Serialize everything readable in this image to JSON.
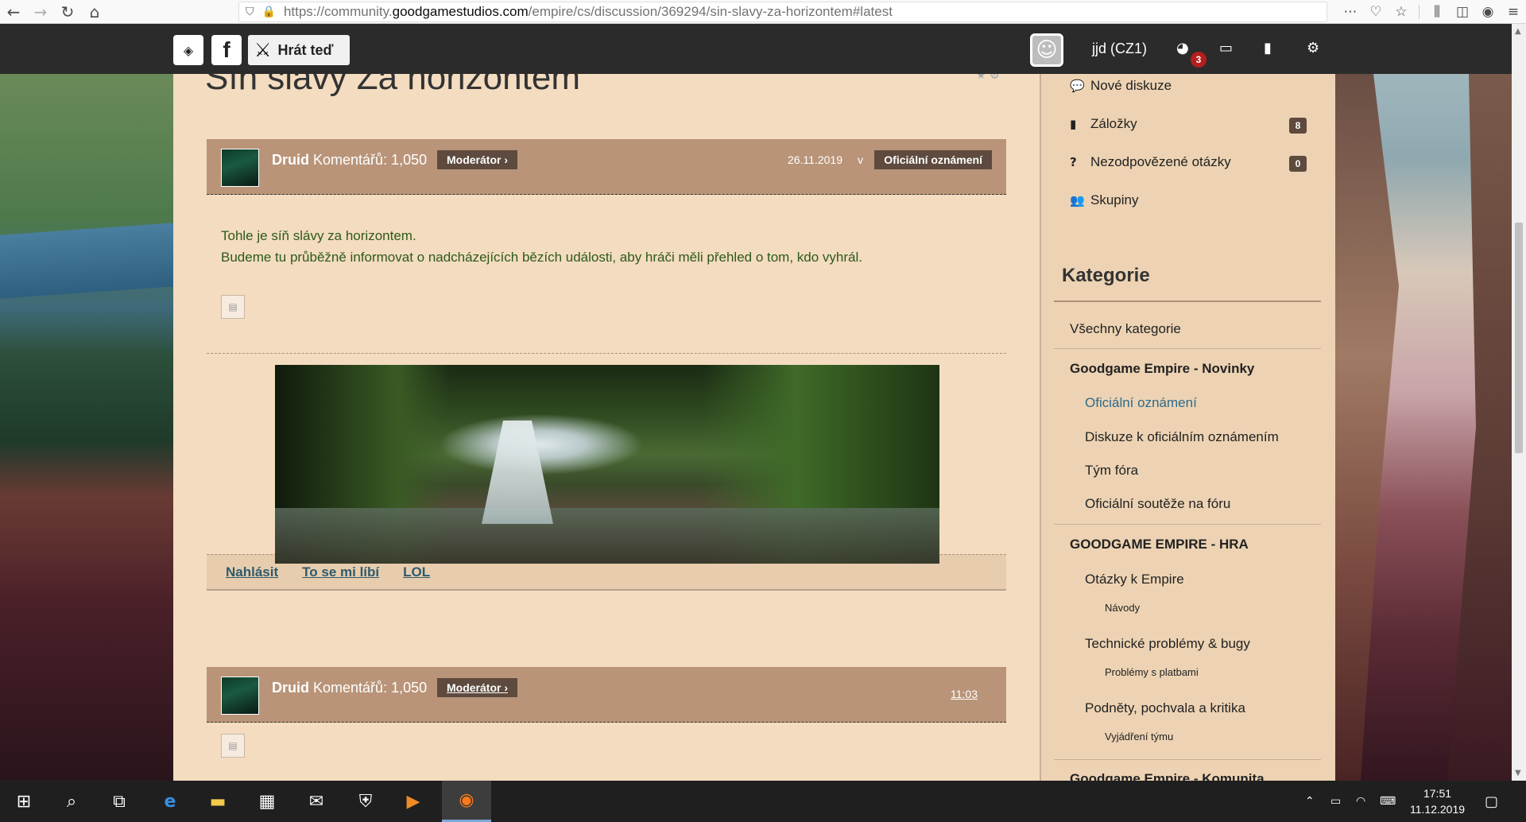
{
  "browser": {
    "url_prefix": "https://community.",
    "url_domain": "goodgamestudios.com",
    "url_path": "/empire/cs/discussion/369294/sin-slavy-za-horizontem#latest",
    "icons": [
      "back-icon",
      "forward-icon",
      "reload-icon",
      "home-icon",
      "shield-icon",
      "lock-icon",
      "more-icon",
      "pocket-icon",
      "star-icon",
      "library-icon",
      "sidebar-icon",
      "account-icon",
      "menu-icon"
    ]
  },
  "header": {
    "play_label": "Hrát teď",
    "username": "jjd (CZ1)",
    "notification_count": "3"
  },
  "page": {
    "title": "Síň slávy Za horizontem"
  },
  "posts": [
    {
      "author": "Druid",
      "comments": "Komentářů: 1,050",
      "role": "Moderátor ›",
      "date": "26.11.2019",
      "in_word": "v",
      "category": "Oficiální oznámení",
      "line1": "Tohle je síň slávy za horizontem.",
      "line2": "Budeme tu průběžně informovat o nadcházejících bězích události, aby hráči měli přehled o tom, kdo vyhrál."
    },
    {
      "author": "Druid",
      "comments": "Komentářů: 1,050",
      "role": "Moderátor ›",
      "date": "11:03"
    }
  ],
  "actions": {
    "report": "Nahlásit",
    "like": "To se mi líbí",
    "lol": "LOL"
  },
  "sidebar": {
    "items": [
      {
        "label": "Nové diskuze",
        "icon": "comments-icon"
      },
      {
        "label": "Záložky",
        "icon": "bookmark-icon",
        "badge": "8"
      },
      {
        "label": "Nezodpovězené otázky",
        "icon": "question-icon",
        "badge": "0"
      },
      {
        "label": "Skupiny",
        "icon": "users-icon"
      }
    ],
    "heading": "Kategorie",
    "categories": {
      "all": "Všechny kategorie",
      "news_group": "Goodgame Empire - Novinky",
      "official": "Oficiální oznámení",
      "official_discussion": "Diskuze k oficiálním oznámením",
      "team": "Tým fóra",
      "contests": "Oficiální soutěže na fóru",
      "game_group": "GOODGAME EMPIRE - HRA",
      "questions": "Otázky k Empire",
      "guides": "Návody",
      "tech": "Technické problémy & bugy",
      "payments": "Problémy s platbami",
      "feedback": "Podněty, pochvala a kritika",
      "team_statements": "Vyjádření týmu",
      "community_group": "Goodgame Empire - Komunita"
    }
  },
  "taskbar": {
    "time": "17:51",
    "date": "11.12.2019",
    "apps": [
      "windows-start-icon",
      "search-icon",
      "task-view-icon",
      "edge-icon",
      "file-explorer-icon",
      "store-icon",
      "mail-icon",
      "security-icon",
      "media-player-icon",
      "firefox-icon"
    ]
  }
}
